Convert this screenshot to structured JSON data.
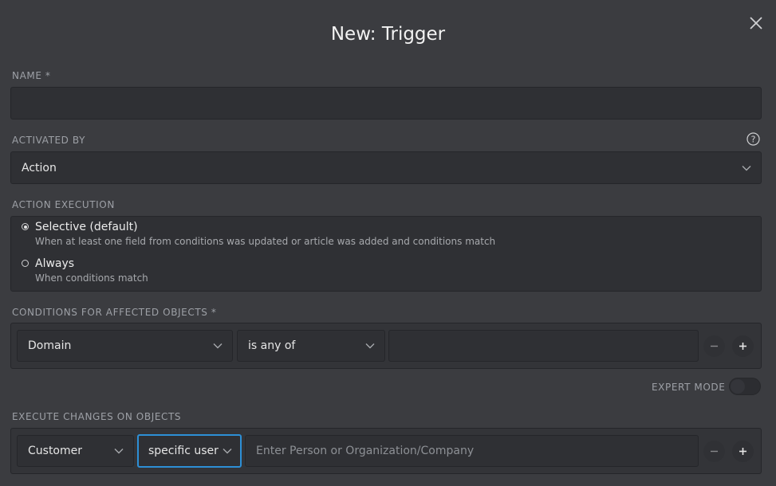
{
  "dialog": {
    "title": "New: Trigger"
  },
  "name_field": {
    "label": "NAME *",
    "value": ""
  },
  "activated_by": {
    "label": "ACTIVATED BY",
    "value": "Action"
  },
  "action_execution": {
    "label": "ACTION EXECUTION",
    "options": [
      {
        "title": "Selective (default)",
        "description": "When at least one field from conditions was updated or article was added and conditions match",
        "checked": true
      },
      {
        "title": "Always",
        "description": "When conditions match",
        "checked": false
      }
    ]
  },
  "conditions": {
    "label": "CONDITIONS FOR AFFECTED OBJECTS *",
    "attribute": "Domain",
    "operator": "is any of",
    "value": ""
  },
  "expert_mode": {
    "label": "EXPERT MODE",
    "enabled": false
  },
  "execute_changes": {
    "label": "EXECUTE CHANGES ON OBJECTS",
    "attribute": "Customer",
    "operator": "specific user",
    "placeholder": "Enter Person or Organization/Company"
  },
  "icons": {
    "close": "close-icon",
    "help": "question-circle-icon",
    "chevron": "chevron-down-icon",
    "minus": "minus-icon",
    "plus": "plus-icon"
  },
  "colors": {
    "background": "#3b3c40",
    "field": "#2f3034",
    "focus_border": "#2d8fd6",
    "label": "#9da0a6"
  }
}
